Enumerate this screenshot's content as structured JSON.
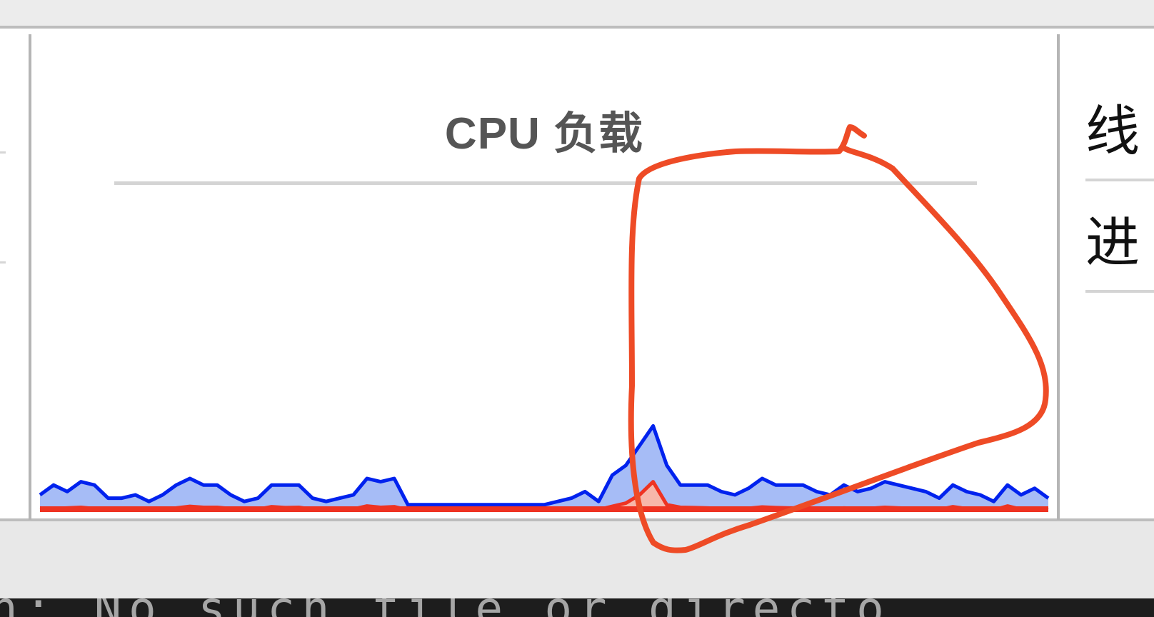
{
  "cpu_panel": {
    "title": "CPU 负载",
    "annotation": {
      "color": "#ee4b26",
      "shape": "freehand-loop"
    }
  },
  "side_panel": {
    "items": [
      "线",
      "进"
    ]
  },
  "terminal": {
    "text": "n: No such file or directo"
  },
  "colors": {
    "user_series": "#0022ee",
    "user_fill": "#a6bcf6",
    "system_series": "#ee3322",
    "system_fill": "#f7b7aa"
  },
  "chart_data": {
    "type": "area",
    "title": "CPU 负载",
    "xlabel": "",
    "ylabel": "",
    "ylim": [
      0,
      100
    ],
    "grid": false,
    "x": [
      0,
      1,
      2,
      3,
      4,
      5,
      6,
      7,
      8,
      9,
      10,
      11,
      12,
      13,
      14,
      15,
      16,
      17,
      18,
      19,
      20,
      21,
      22,
      23,
      24,
      25,
      26,
      27,
      28,
      29,
      30,
      31,
      32,
      33,
      34,
      35,
      36,
      37,
      38,
      39,
      40,
      41,
      42,
      43,
      44,
      45,
      46,
      47,
      48,
      49,
      50,
      51,
      52,
      53,
      54,
      55,
      56,
      57,
      58,
      59,
      60,
      61,
      62,
      63,
      64,
      65,
      66,
      67,
      68,
      69,
      70,
      71,
      72,
      73,
      74
    ],
    "series": [
      {
        "name": "",
        "color": "#0022ee",
        "values": [
          5,
          8,
          6,
          9,
          8,
          4,
          4,
          5,
          3,
          5,
          8,
          10,
          8,
          8,
          5,
          3,
          4,
          8,
          8,
          8,
          4,
          3,
          4,
          5,
          10,
          9,
          10,
          2,
          2,
          2,
          2,
          2,
          2,
          2,
          2,
          2,
          2,
          2,
          3,
          4,
          6,
          3,
          11,
          14,
          20,
          26,
          14,
          8,
          8,
          8,
          6,
          5,
          7,
          10,
          8,
          8,
          8,
          6,
          5,
          8,
          6,
          7,
          9,
          8,
          7,
          6,
          4,
          8,
          6,
          5,
          3,
          8,
          5,
          7,
          4
        ]
      },
      {
        "name": "",
        "color": "#ee3322",
        "values": [
          0.5,
          0.8,
          1,
          1.2,
          0.8,
          0.6,
          0.6,
          0.8,
          0.5,
          0.7,
          1,
          1.5,
          1.2,
          1.2,
          0.8,
          0.5,
          0.6,
          1.4,
          1.1,
          1.2,
          0.6,
          0.5,
          0.6,
          0.7,
          1.6,
          1.2,
          1.4,
          0.4,
          0.4,
          0.4,
          0.4,
          0.4,
          0.4,
          0.4,
          0.4,
          0.4,
          0.4,
          0.4,
          0.4,
          0.6,
          0.8,
          0.5,
          1.5,
          2.5,
          5,
          9,
          2,
          1.2,
          1.1,
          1,
          0.8,
          0.7,
          0.9,
          1.3,
          1.1,
          1,
          1,
          0.8,
          0.6,
          1,
          0.8,
          0.9,
          1.2,
          1,
          0.9,
          0.8,
          0.5,
          1.4,
          0.8,
          0.6,
          0.4,
          1.6,
          0.6,
          0.9,
          0.5
        ]
      }
    ]
  }
}
